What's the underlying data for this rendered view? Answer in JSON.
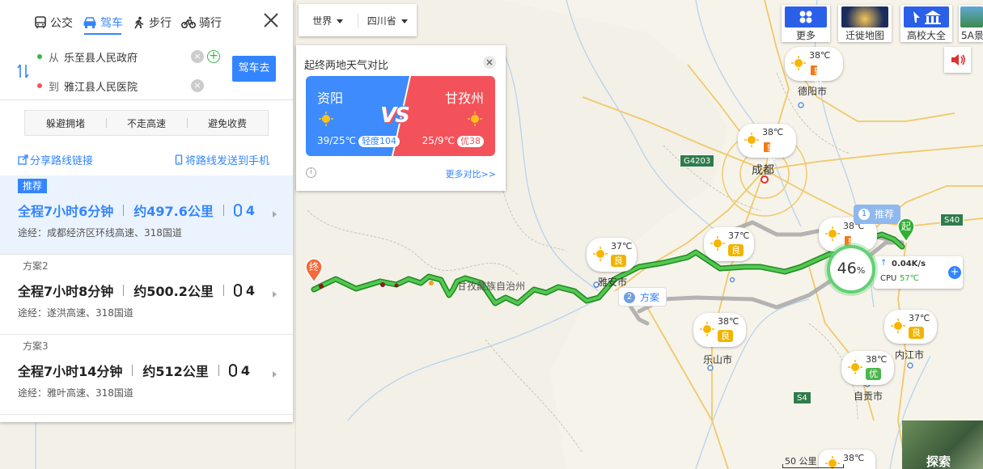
{
  "modes": [
    {
      "label": "公交",
      "icon": "bus-icon"
    },
    {
      "label": "驾车",
      "icon": "car-icon",
      "active": true
    },
    {
      "label": "步行",
      "icon": "walk-icon"
    },
    {
      "label": "骑行",
      "icon": "bike-icon"
    }
  ],
  "route": {
    "from_label": "从",
    "from_value": "乐至县人民政府",
    "to_label": "到",
    "to_value": "雅江县人民医院",
    "go_button": "驾车去"
  },
  "preferences": [
    "躲避拥堵",
    "不走高速",
    "避免收费"
  ],
  "share": {
    "link_label": "分享路线链接",
    "phone_label": "将路线发送到手机"
  },
  "plans": [
    {
      "tag": "推荐",
      "duration": "全程7小时6分钟",
      "distance": "约497.6公里",
      "lights": "4",
      "via": "途经：成都经济区环线高速、318国道"
    },
    {
      "tag": "方案2",
      "duration": "全程7小时8分钟",
      "distance": "约500.2公里",
      "lights": "4",
      "via": "途经：遂洪高速、318国道"
    },
    {
      "tag": "方案3",
      "duration": "全程7小时14分钟",
      "distance": "约512公里",
      "lights": "4",
      "via": "途经：雅叶高速、318国道"
    }
  ],
  "region": {
    "world": "世界",
    "province": "四川省"
  },
  "weather": {
    "title": "起终两地天气对比",
    "left": {
      "city": "资阳",
      "temp": "39/25℃",
      "aq": "轻度104"
    },
    "vs": "VS",
    "right": {
      "city": "甘孜州",
      "temp": "25/9℃",
      "aq": "优38"
    },
    "more": "更多对比>>",
    "info": "i"
  },
  "right_buttons": [
    {
      "label": "更多",
      "icon": "grid-icon"
    },
    {
      "label": "迁徙地图",
      "icon": "migration-map-icon"
    },
    {
      "label": "高校大全",
      "icon": "university-icon"
    },
    {
      "label": "5A景",
      "icon": "scenic-icon"
    }
  ],
  "map_pins": [
    {
      "temp": "38℃",
      "aq": "轻度",
      "level": "light"
    },
    {
      "temp": "38℃",
      "aq": "轻度",
      "level": "light"
    },
    {
      "temp": "38℃",
      "aq": "轻度",
      "level": "light"
    },
    {
      "temp": "37℃",
      "aq": "良",
      "level": "good"
    },
    {
      "temp": "37℃",
      "aq": "良",
      "level": "good"
    },
    {
      "temp": "38℃",
      "aq": "良",
      "level": "good"
    },
    {
      "temp": "37℃",
      "aq": "良",
      "level": "good"
    },
    {
      "temp": "38℃",
      "aq": "优",
      "level": "excellent"
    },
    {
      "temp": "38℃",
      "aq": "",
      "level": "good"
    }
  ],
  "cities": [
    "德阳市",
    "成都",
    "雅安市",
    "乐山市",
    "内江市",
    "自贡市",
    "甘孜藏族自治州"
  ],
  "highway_shields": [
    "G4203",
    "S40",
    "S4"
  ],
  "route_tags": {
    "recommended": {
      "num": "1",
      "label": "推荐"
    },
    "alternative": {
      "num": "2",
      "label": "方案"
    },
    "start": "起",
    "end": "终"
  },
  "cpu": {
    "percent": "46",
    "unit": "%",
    "speed": "0.04K/s",
    "cpu_label": "CPU",
    "cpu_temp": "57℃"
  },
  "scale": "50 公里",
  "explore": "探索",
  "colors": {
    "accent": "#3385ff",
    "route": "#2fb02f",
    "alt_route": "#a9a9a9",
    "weather_left": "#3d8bfd",
    "weather_right": "#f4525b"
  }
}
